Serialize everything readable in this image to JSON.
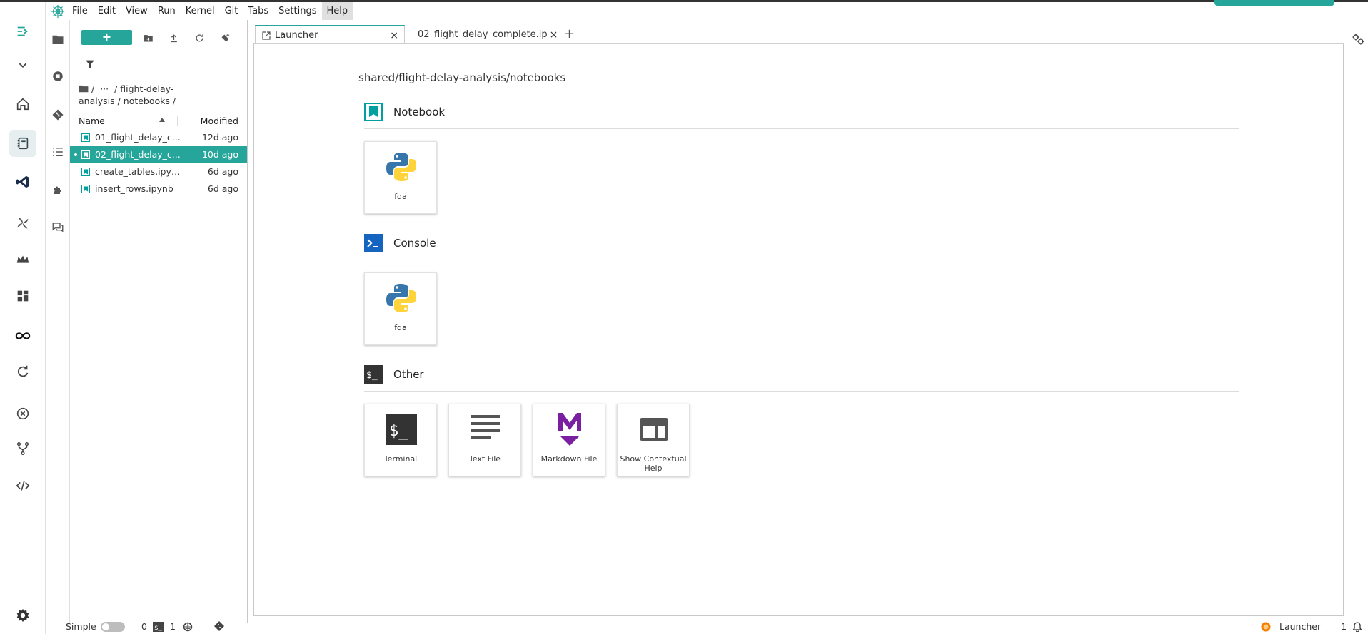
{
  "menubar": {
    "items": [
      "File",
      "Edit",
      "View",
      "Run",
      "Kernel",
      "Git",
      "Tabs",
      "Settings",
      "Help"
    ],
    "active": "Help"
  },
  "filebrowser": {
    "new_label": "+",
    "breadcrumb": {
      "root": "/",
      "ellipsis": "···",
      "path": "/ flight-delay-analysis / notebooks /"
    },
    "columns": {
      "name": "Name",
      "modified": "Modified"
    },
    "files": [
      {
        "name": "01_flight_delay_c...",
        "modified": "12d ago",
        "selected": false
      },
      {
        "name": "02_flight_delay_c...",
        "modified": "10d ago",
        "selected": true
      },
      {
        "name": "create_tables.ipynb",
        "modified": "6d ago",
        "selected": false
      },
      {
        "name": "insert_rows.ipynb",
        "modified": "6d ago",
        "selected": false
      }
    ]
  },
  "tabs": [
    {
      "label": "Launcher",
      "active": true,
      "close": "×"
    },
    {
      "label": "02_flight_delay_complete.ip",
      "active": false,
      "close": "×"
    }
  ],
  "new_tab": "+",
  "launcher": {
    "cwd": "shared/flight-delay-analysis/notebooks",
    "sections": [
      {
        "title": "Notebook",
        "cards": [
          {
            "label": "fda",
            "icon": "python-icon"
          }
        ]
      },
      {
        "title": "Console",
        "cards": [
          {
            "label": "fda",
            "icon": "python-icon"
          }
        ]
      },
      {
        "title": "Other",
        "cards": [
          {
            "label": "Terminal",
            "icon": "terminal-icon"
          },
          {
            "label": "Text File",
            "icon": "text-file-icon"
          },
          {
            "label": "Markdown File",
            "icon": "markdown-icon"
          },
          {
            "label": "Show Contextual Help",
            "icon": "contextual-help-icon"
          }
        ]
      }
    ]
  },
  "statusbar": {
    "mode": "Simple",
    "terminals": "0",
    "kernels": "1",
    "current": "Launcher",
    "notifications": "1"
  },
  "colors": {
    "accent": "#26a69a",
    "notebook_icon": "#00a0a0",
    "markdown": "#7b1fa2",
    "console_icon": "#1565c0"
  }
}
